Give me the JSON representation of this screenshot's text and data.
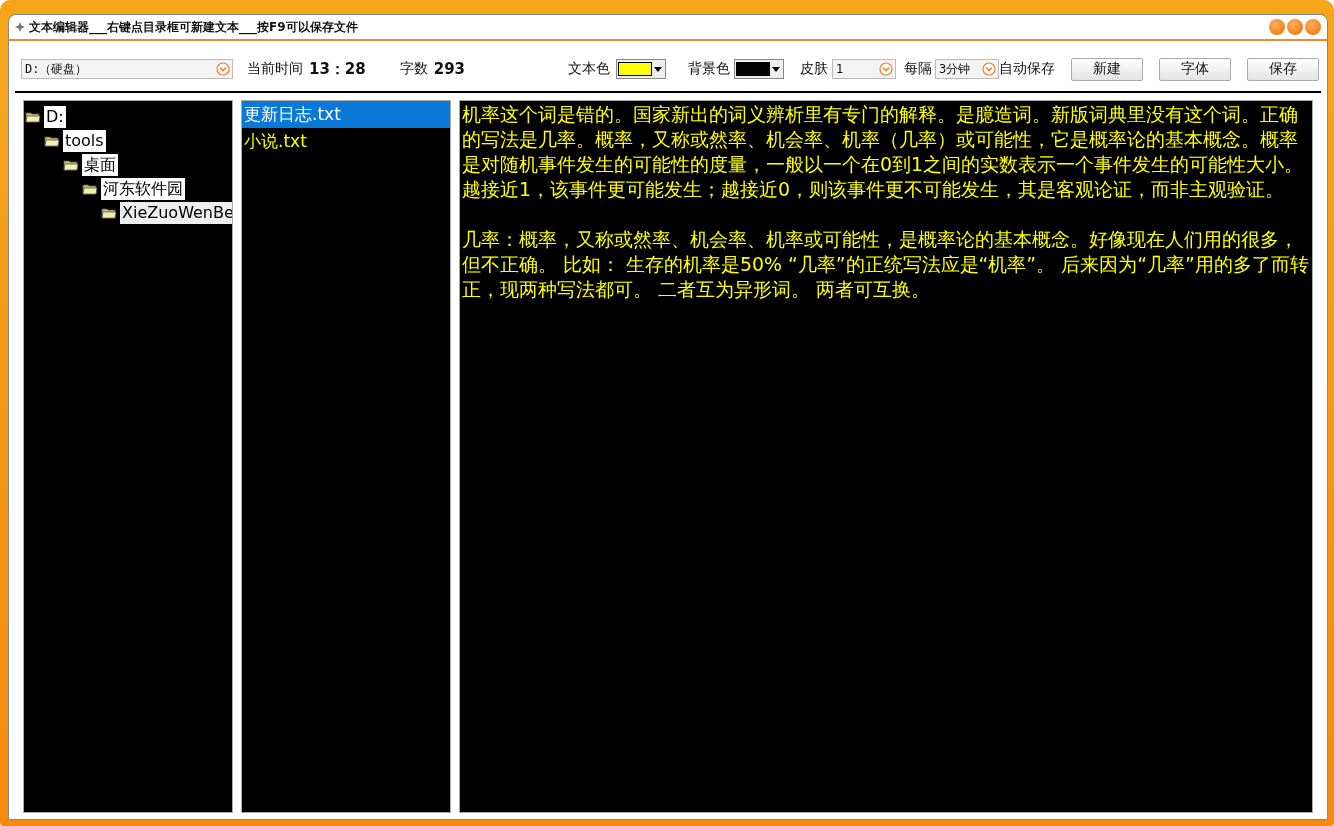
{
  "window": {
    "title": "文本编辑器___右键点目录框可新建文本___按F9可以保存文件"
  },
  "toolbar": {
    "drive": {
      "value": "D:（硬盘）"
    },
    "time_label": "当前时间",
    "time": "13：28",
    "count_label": "字数",
    "count": "293",
    "text_color": {
      "label": "文本色",
      "color": "#ffff00"
    },
    "background_color": {
      "label": "背景色",
      "color": "#000000"
    },
    "skin": {
      "label": "皮肤",
      "value": "1"
    },
    "interval": {
      "label": "每隔",
      "value": "3分钟",
      "suffix": "自动保存"
    },
    "buttons": [
      "新建",
      "字体",
      "保存"
    ]
  },
  "tree": [
    {
      "label": "D:",
      "selected": false,
      "children": [
        {
          "label": "tools",
          "selected": false,
          "children": [
            {
              "label": "桌面",
              "selected": false,
              "children": [
                {
                  "label": "河东软件园",
                  "selected": false,
                  "children": [
                    {
                      "label": "XieZuoWenBe",
                      "selected": true
                    }
                  ]
                }
              ]
            }
          ]
        }
      ]
    }
  ],
  "files": [
    {
      "name": "更新日志.txt",
      "selected": true
    },
    {
      "name": "小说.txt",
      "selected": false
    }
  ],
  "editor": {
    "paragraphs": [
      "机率这个词是错的。国家新出的词义辨析里有专门的解释。是臆造词。新版词典里没有这个词。正确的写法是几率。概率，又称或然率、机会率、机率（几率）或可能性，它是概率论的基本概念。概率是对随机事件发生的可能性的度量，一般以一个在0到1之间的实数表示一个事件发生的可能性大小。越接近1，该事件更可能发生；越接近0，则该事件更不可能发生，其是客观论证，而非主观验证。",
      "几率：概率，又称或然率、机会率、机率或可能性，是概率论的基本概念。好像现在人们用的很多，但不正确。 比如： 生存的机率是50% “几率”的正统写法应是“机率”。 后来因为“几率”用的多了而转正，现两种写法都可。 二者互为异形词。 两者可互换。"
    ]
  }
}
